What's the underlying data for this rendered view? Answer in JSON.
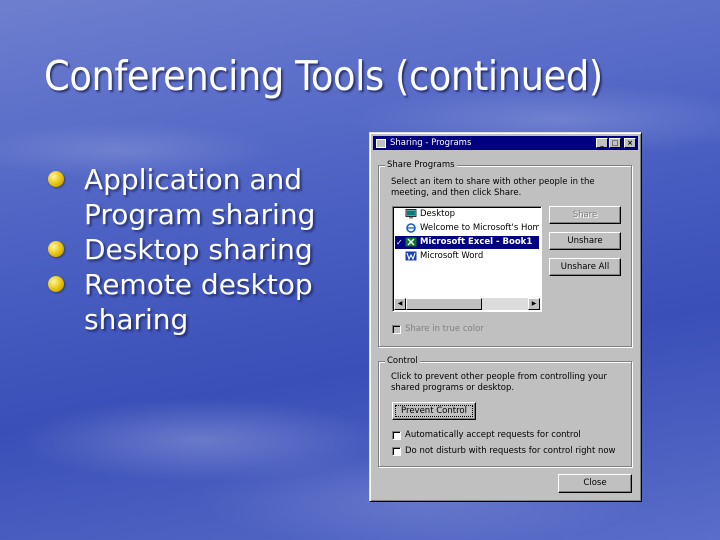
{
  "slide": {
    "title": "Conferencing Tools (continued)",
    "bullets": [
      "Application and Program sharing",
      "Desktop sharing",
      "Remote desktop sharing"
    ]
  },
  "dialog": {
    "title": "Sharing - Programs",
    "window_controls": {
      "minimize": "_",
      "maximize": "□",
      "close": "×"
    },
    "share_group": {
      "legend": "Share Programs",
      "instructions": "Select an item to share with other people in the meeting, and then click Share.",
      "items": [
        {
          "label": "Desktop",
          "icon": "desktop-icon",
          "checked": false,
          "selected": false
        },
        {
          "label": "Welcome to Microsoft's Homep",
          "icon": "ie-icon",
          "checked": false,
          "selected": false
        },
        {
          "label": "Microsoft Excel - Book1",
          "icon": "excel-icon",
          "checked": true,
          "selected": true
        },
        {
          "label": "Microsoft Word",
          "icon": "word-icon",
          "checked": false,
          "selected": false
        }
      ],
      "check_mark": "✓",
      "share_button": "Share",
      "unshare_button": "Unshare",
      "unshare_all_button": "Unshare All",
      "true_color_label": "Share in true color"
    },
    "control_group": {
      "legend": "Control",
      "instructions": "Click to prevent other people from controlling your shared programs or desktop.",
      "prevent_button": "Prevent Control",
      "auto_accept_label": "Automatically accept requests for control",
      "do_not_disturb_label": "Do not disturb with requests for control right now"
    },
    "close_button": "Close"
  },
  "colors": {
    "background": "#4e63c4",
    "bullet": "#e6c000",
    "title_bar": "#000080",
    "dialog_face": "#c0c0c0"
  }
}
